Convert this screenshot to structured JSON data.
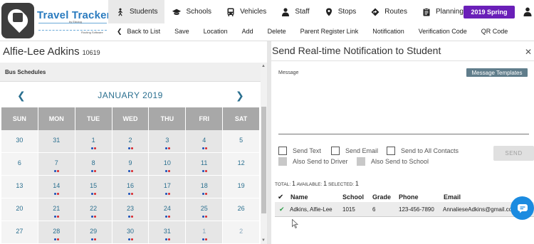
{
  "app": {
    "logo_title": "Travel Tracker",
    "logo_by": "by Edulog",
    "logo_tagline": "Routing Software"
  },
  "nav": {
    "tabs": [
      {
        "label": "Students",
        "icon": "student-icon",
        "active": true
      },
      {
        "label": "Schools",
        "icon": "graduation-cap-icon"
      },
      {
        "label": "Vehicles",
        "icon": "bus-icon"
      },
      {
        "label": "Staff",
        "icon": "person-icon"
      },
      {
        "label": "Stops",
        "icon": "map-pin-icon"
      },
      {
        "label": "Routes",
        "icon": "route-diamond-icon"
      },
      {
        "label": "Planning",
        "icon": "clipboard-icon"
      }
    ],
    "season": "2019 Spring"
  },
  "toolbar": {
    "back": "Back to List",
    "save": "Save",
    "location": "Location",
    "add": "Add",
    "delete": "Delete",
    "parent_register_link": "Parent Register Link",
    "notification": "Notification",
    "verification_code": "Verification Code",
    "qr_code": "QR Code"
  },
  "student": {
    "name": "Alfie-Lee Adkins",
    "id": "10619"
  },
  "schedules": {
    "title": "Bus Schedules"
  },
  "calendar": {
    "month": "JANUARY 2019",
    "days_of_week": [
      "SUN",
      "MON",
      "TUE",
      "WED",
      "THU",
      "FRI",
      "SAT"
    ],
    "weeks": [
      [
        {
          "d": "30"
        },
        {
          "d": "31"
        },
        {
          "d": "1",
          "dots": true
        },
        {
          "d": "2",
          "dots": true
        },
        {
          "d": "3",
          "dots": true
        },
        {
          "d": "4",
          "dots": true
        },
        {
          "d": "5"
        }
      ],
      [
        {
          "d": "6"
        },
        {
          "d": "7",
          "dots": true
        },
        {
          "d": "8",
          "dots": true
        },
        {
          "d": "9",
          "dots": true
        },
        {
          "d": "10",
          "dots": true
        },
        {
          "d": "11",
          "dots": true
        },
        {
          "d": "12"
        }
      ],
      [
        {
          "d": "13"
        },
        {
          "d": "14",
          "dots": true
        },
        {
          "d": "15",
          "dots": true
        },
        {
          "d": "16",
          "dots": true
        },
        {
          "d": "17",
          "dots": true
        },
        {
          "d": "18",
          "dots": true
        },
        {
          "d": "19"
        }
      ],
      [
        {
          "d": "20"
        },
        {
          "d": "21",
          "dots": true
        },
        {
          "d": "22",
          "dots": true
        },
        {
          "d": "23",
          "dots": true
        },
        {
          "d": "24",
          "dots": true
        },
        {
          "d": "25",
          "dots": true
        },
        {
          "d": "26"
        }
      ],
      [
        {
          "d": "27"
        },
        {
          "d": "28",
          "dots": true
        },
        {
          "d": "29",
          "dots": true
        },
        {
          "d": "30",
          "dots": true
        },
        {
          "d": "31",
          "dots": true
        },
        {
          "d": "1",
          "dots": true,
          "dim": true
        },
        {
          "d": "2",
          "dim": true
        }
      ]
    ]
  },
  "notification_panel": {
    "title": "Send Real-time Notification to Student",
    "message_label": "Message",
    "message_value": "",
    "templates_button": "Message Templates",
    "options": {
      "send_text": "Send Text",
      "send_email": "Send Email",
      "send_all_contacts": "Send to All Contacts",
      "also_driver": "Also Send to Driver",
      "also_school": "Also Send to School"
    },
    "send_button": "SEND",
    "totals": {
      "total_label": "TOTAL:",
      "total": "1",
      "available_label": "AVAILABLE:",
      "available": "1",
      "selected_label": "SELECTED:",
      "selected": "1"
    },
    "table": {
      "columns": [
        "Name",
        "School",
        "Grade",
        "Phone",
        "Email"
      ],
      "rows": [
        {
          "name": "Adkins, Alfie-Lee",
          "school": "1015",
          "grade": "6",
          "phone": "123-456-7890",
          "email": "AnnalieseAdkins@gmail.com"
        }
      ]
    }
  },
  "colors": {
    "accent": "#2a6f8f",
    "season_button": "#6a1fb8",
    "templates_button": "#607d8b",
    "chat_button": "#1b8be0",
    "dot_blue": "#1a4fb8",
    "dot_red": "#d8262c"
  }
}
